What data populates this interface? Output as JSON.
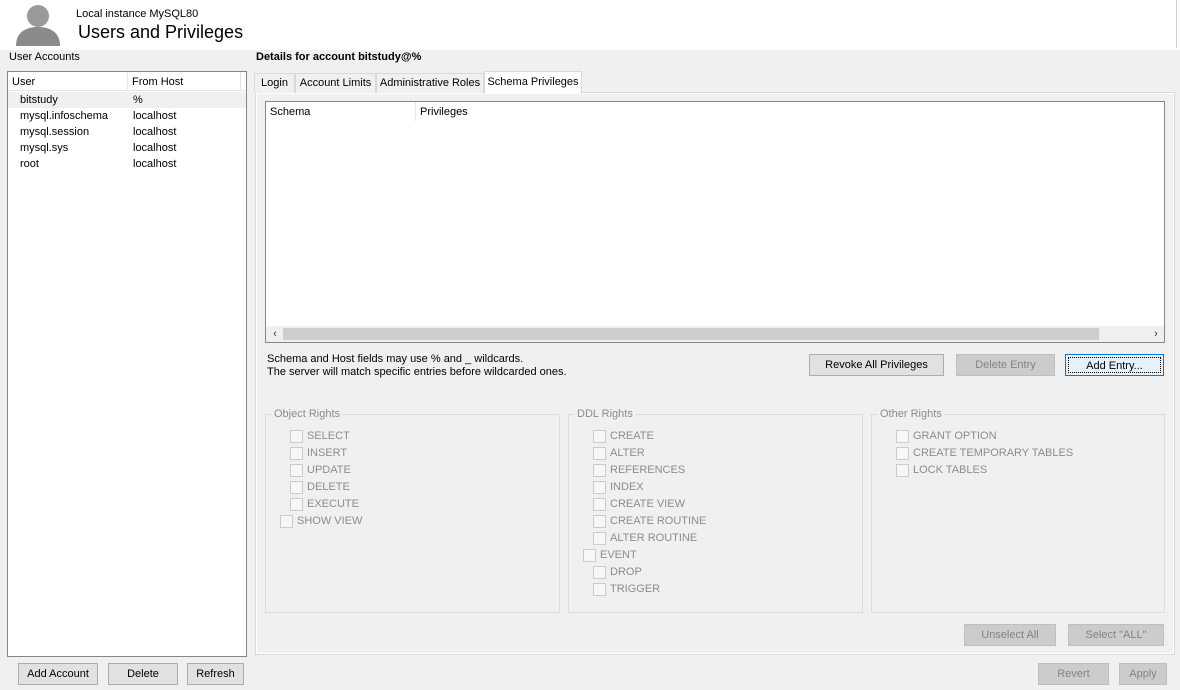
{
  "header": {
    "instance": "Local instance MySQL80",
    "title": "Users and Privileges"
  },
  "accounts": {
    "heading": "User Accounts",
    "columns": {
      "user": "User",
      "host": "From Host"
    },
    "rows": [
      {
        "user": "bitstudy",
        "host": "%"
      },
      {
        "user": "mysql.infoschema",
        "host": "localhost"
      },
      {
        "user": "mysql.session",
        "host": "localhost"
      },
      {
        "user": "mysql.sys",
        "host": "localhost"
      },
      {
        "user": "root",
        "host": "localhost"
      }
    ],
    "add_label": "Add Account",
    "delete_label": "Delete",
    "refresh_label": "Refresh"
  },
  "details": {
    "title": "Details for account bitstudy@%",
    "tabs": [
      {
        "label": "Login"
      },
      {
        "label": "Account Limits"
      },
      {
        "label": "Administrative Roles"
      },
      {
        "label": "Schema Privileges"
      }
    ],
    "schema_table": {
      "col_schema": "Schema",
      "col_privileges": "Privileges"
    },
    "hint_line1": "Schema and Host fields may use % and _ wildcards.",
    "hint_line2": "The server will match specific entries before wildcarded ones.",
    "revoke_label": "Revoke All Privileges",
    "delete_entry_label": "Delete Entry",
    "add_entry_label": "Add Entry...",
    "object_rights": {
      "title": "Object Rights",
      "items": [
        "SELECT",
        "INSERT",
        "UPDATE",
        "DELETE",
        "EXECUTE",
        "SHOW VIEW"
      ]
    },
    "ddl_rights": {
      "title": "DDL Rights",
      "items": [
        "CREATE",
        "ALTER",
        "REFERENCES",
        "INDEX",
        "CREATE VIEW",
        "CREATE ROUTINE",
        "ALTER ROUTINE",
        "EVENT",
        "DROP",
        "TRIGGER"
      ]
    },
    "other_rights": {
      "title": "Other Rights",
      "items": [
        "GRANT OPTION",
        "CREATE TEMPORARY TABLES",
        "LOCK TABLES"
      ]
    },
    "unselect_all_label": "Unselect All",
    "select_all_label": "Select \"ALL\"",
    "revert_label": "Revert",
    "apply_label": "Apply"
  }
}
